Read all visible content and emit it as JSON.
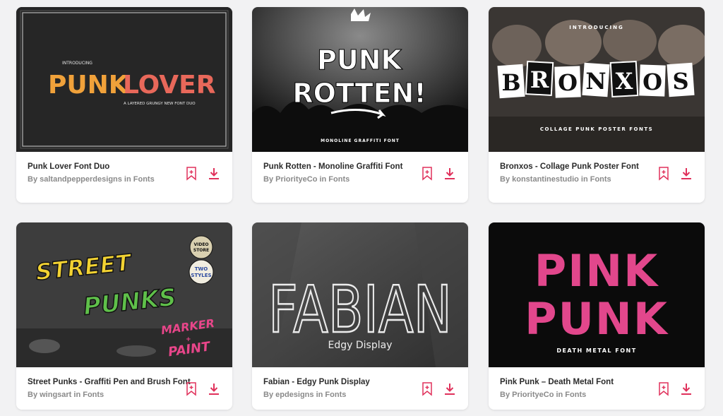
{
  "colors": {
    "accent": "#e0315b"
  },
  "cards": [
    {
      "title": "Punk Lover Font Duo",
      "byline": "By saltandpepperdesigns in Fonts",
      "art": {
        "kicker": "INTRODUCING",
        "word1": "PUNK",
        "word2": "LOVER",
        "tagline": "A LAYERED GRUNGY NEW FONT DUO"
      }
    },
    {
      "title": "Punk Rotten - Monoline Graffiti Font",
      "byline": "By PriorityeCo in Fonts",
      "art": {
        "word1": "PUNK",
        "word2": "ROTTEN!",
        "tagline": "MONOLINE GRAFFITI FONT"
      }
    },
    {
      "title": "Bronxos - Collage Punk Poster Font",
      "byline": "By konstantinestudio in Fonts",
      "art": {
        "kicker": "INTRODUCING",
        "letters": [
          "B",
          "R",
          "O",
          "N",
          "X",
          "O",
          "S"
        ],
        "tagline": "COLLAGE PUNK POSTER FONTS"
      }
    },
    {
      "title": "Street Punks - Graffiti Pen and Brush Font",
      "byline": "By wingsart in Fonts",
      "art": {
        "word1": "STREET",
        "word2": "PUNKS",
        "word3": "MARKER",
        "plus": "+",
        "word4": "PAINT",
        "badge1a": "VIDEO",
        "badge1b": "STORE",
        "badge2a": "TWO",
        "badge2b": "STYLES"
      }
    },
    {
      "title": "Fabian - Edgy Punk Display",
      "byline": "By epdesigns in Fonts",
      "art": {
        "word1": "FABIAN",
        "tagline": "Edgy Display"
      }
    },
    {
      "title": "Pink Punk – Death Metal Font",
      "byline": "By PriorityeCo in Fonts",
      "art": {
        "word1": "PINK",
        "word2": "PUNK",
        "tagline": "DEATH METAL FONT"
      }
    }
  ]
}
